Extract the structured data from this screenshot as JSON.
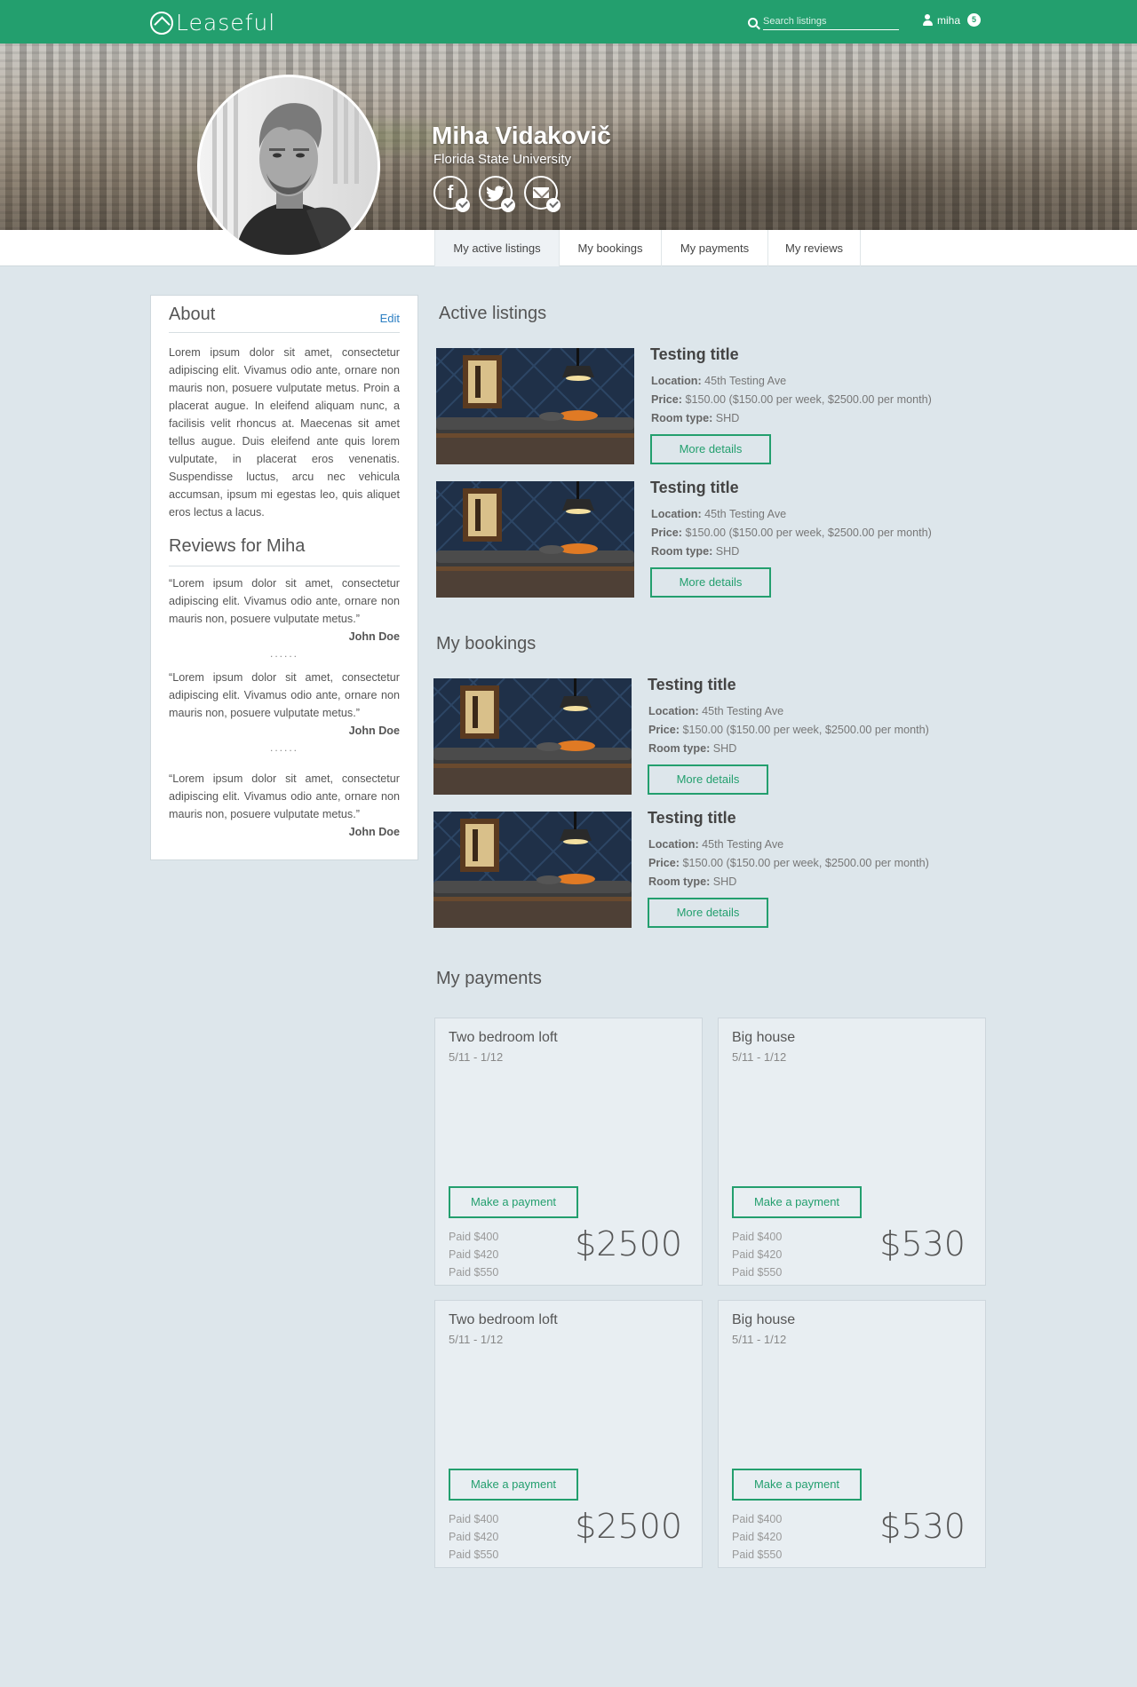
{
  "app": {
    "name": "Leaseful"
  },
  "search": {
    "placeholder": "Search listings"
  },
  "user": {
    "name": "miha",
    "notifications": "5"
  },
  "profile": {
    "name": "Miha Vidakovič",
    "school": "Florida State University",
    "social": [
      {
        "icon": "facebook-icon",
        "glyph": "f",
        "verified": true
      },
      {
        "icon": "twitter-icon",
        "glyph": "t",
        "verified": true
      },
      {
        "icon": "email-icon",
        "glyph": "",
        "verified": true
      }
    ]
  },
  "tabs": [
    "My active listings",
    "My bookings",
    "My payments",
    "My reviews"
  ],
  "about": {
    "title": "About",
    "edit_label": "Edit",
    "text": "Lorem ipsum dolor sit amet, consectetur adipiscing elit. Vivamus odio ante, ornare non mauris non, posuere vulputate metus. Proin a placerat augue. In eleifend aliquam nunc, a facilisis velit rhoncus at. Maecenas sit amet tellus augue. Duis eleifend ante quis lorem vulputate, in placerat eros venenatis. Suspendisse luctus, arcu nec vehicula accumsan, ipsum mi egestas leo, quis aliquet eros lectus a lacus."
  },
  "reviews": {
    "title": "Reviews for Miha",
    "separator": "......",
    "items": [
      {
        "text": "“Lorem ipsum dolor sit amet, consectetur adipiscing elit. Vivamus odio ante, ornare non mauris non, posuere vulputate metus.”",
        "author": "John Doe"
      },
      {
        "text": "“Lorem ipsum dolor sit amet, consectetur adipiscing elit. Vivamus odio ante, ornare non mauris non, posuere vulputate metus.”",
        "author": "John Doe"
      },
      {
        "text": "“Lorem ipsum dolor sit amet, consectetur adipiscing elit. Vivamus odio ante, ornare non mauris non, posuere vulputate metus.”",
        "author": "John Doe"
      }
    ]
  },
  "active_listings": {
    "title": "Active listings",
    "items": [
      {
        "title": "Testing title",
        "location_label": "Location:",
        "location": "45th Testing Ave",
        "price_label": "Price:",
        "price": "$150.00 ($150.00 per week, $2500.00 per month)",
        "room_label": "Room type:",
        "room": "SHD",
        "button": "More details"
      },
      {
        "title": "Testing title",
        "location_label": "Location:",
        "location": "45th Testing Ave",
        "price_label": "Price:",
        "price": "$150.00 ($150.00 per week, $2500.00 per month)",
        "room_label": "Room type:",
        "room": "SHD",
        "button": "More details"
      }
    ]
  },
  "bookings": {
    "title": "My bookings",
    "items": [
      {
        "title": "Testing title",
        "location_label": "Location:",
        "location": "45th Testing Ave",
        "price_label": "Price:",
        "price": "$150.00 ($150.00 per week, $2500.00 per month)",
        "room_label": "Room type:",
        "room": "SHD",
        "button": "More details"
      },
      {
        "title": "Testing title",
        "location_label": "Location:",
        "location": "45th Testing Ave",
        "price_label": "Price:",
        "price": "$150.00 ($150.00 per week, $2500.00 per month)",
        "room_label": "Room type:",
        "room": "SHD",
        "button": "More details"
      }
    ]
  },
  "payments": {
    "title": "My payments",
    "items": [
      {
        "title": "Two bedroom loft",
        "dates": "5/11 - 1/12",
        "button": "Make a payment",
        "history": [
          "Paid $400",
          "Paid $420",
          "Paid $550"
        ],
        "amount": "$2500"
      },
      {
        "title": "Big house",
        "dates": "5/11 - 1/12",
        "button": "Make a payment",
        "history": [
          "Paid $400",
          "Paid $420",
          "Paid $550"
        ],
        "amount": "$530"
      },
      {
        "title": "Two bedroom loft",
        "dates": "5/11 - 1/12",
        "button": "Make a payment",
        "history": [
          "Paid $400",
          "Paid $420",
          "Paid $550"
        ],
        "amount": "$2500"
      },
      {
        "title": "Big house",
        "dates": "5/11 - 1/12",
        "button": "Make a payment",
        "history": [
          "Paid $400",
          "Paid $420",
          "Paid $550"
        ],
        "amount": "$530"
      }
    ]
  },
  "colors": {
    "brand": "#239f6e",
    "background": "#dde6eb",
    "link": "#2c7fc3"
  }
}
